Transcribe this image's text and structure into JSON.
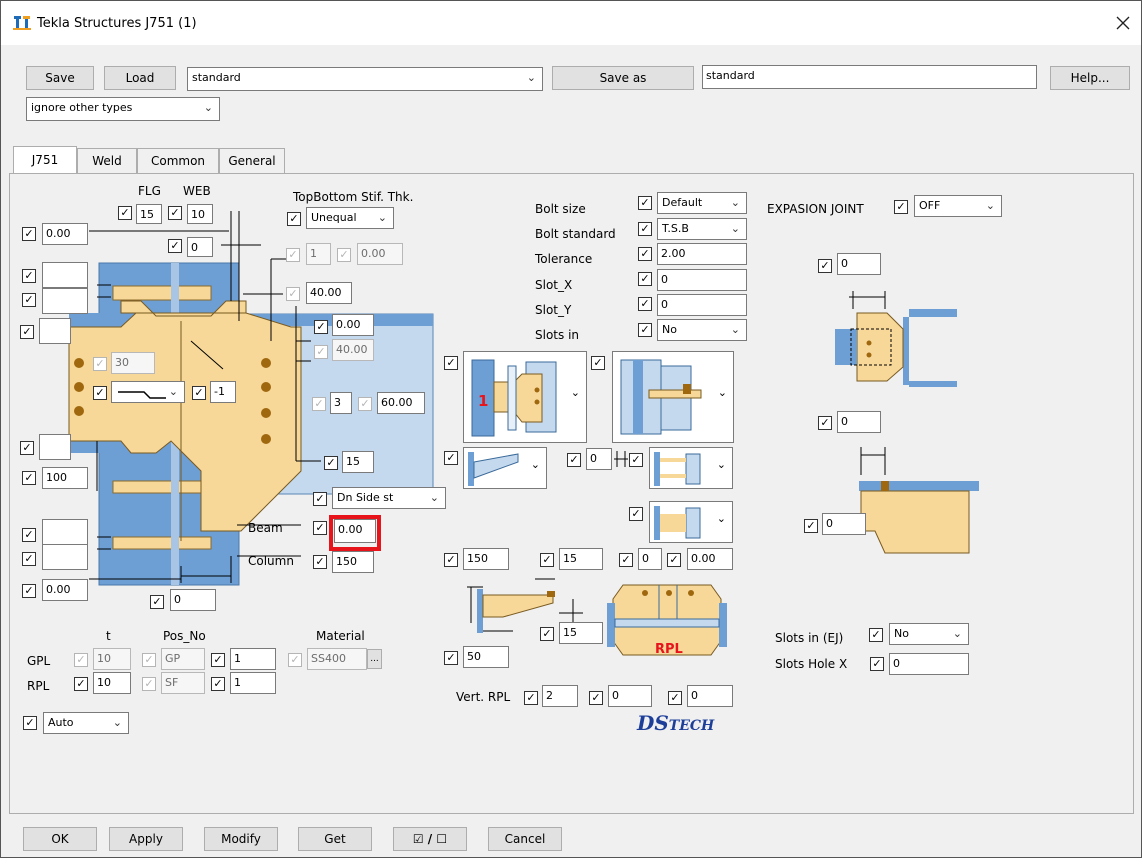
{
  "window": {
    "title": "Tekla Structures  J751 (1)"
  },
  "toolbar": {
    "save": "Save",
    "load": "Load",
    "preset": "standard",
    "save_as": "Save as",
    "save_as_name": "standard",
    "help": "Help...",
    "filter": "ignore other types"
  },
  "tabs": [
    "J751",
    "Weld",
    "Common",
    "General"
  ],
  "stiffener": {
    "flg_label": "FLG",
    "web_label": "WEB",
    "flg": "15",
    "web": "10",
    "topbottom_label": "TopBottom Stif. Thk.",
    "topbottom_value": "Unequal",
    "web_gap": "0",
    "left_top": "0.00",
    "val_1": "1",
    "val_1b": "0.00",
    "val_40": "40.00",
    "val_0_00": "0.00",
    "val_40b": "40.00",
    "val_30": "30",
    "val_m1": "-1",
    "val_3": "3",
    "val_60": "60.00",
    "val_15": "15",
    "val_100": "100",
    "side_stiff": "Dn Side st",
    "beam_label": "Beam",
    "beam_value": "0.00",
    "column_label": "Column",
    "column_value": "150",
    "bottom_left": "0.00",
    "bottom_gap": "0"
  },
  "bolt": {
    "size_label": "Bolt size",
    "size": "Default",
    "standard_label": "Bolt standard",
    "standard": "T.S.B",
    "tolerance_label": "Tolerance",
    "tolerance": "2.00",
    "slotx_label": "Slot_X",
    "slotx": "0",
    "sloty_label": "Slot_Y",
    "sloty": "0",
    "slotsin_label": "Slots in",
    "slotsin": "No"
  },
  "expansion": {
    "label": "EXPASION JOINT",
    "value": "OFF",
    "v1": "0",
    "v2": "0",
    "v3": "0",
    "slots_ej_label": "Slots in (EJ)",
    "slots_ej": "No",
    "hole_x_label": "Slots Hole X",
    "hole_x": "0"
  },
  "mid": {
    "gap_a": "0",
    "v150": "150",
    "v15a": "15",
    "v0a": "0",
    "v000": "0.00",
    "v15b": "15",
    "v50": "50",
    "vert_rpl_label": "Vert. RPL",
    "vert_rpl": "2",
    "vr2": "0",
    "vr3": "0",
    "rpl_text": "RPL",
    "beam_marker": "1"
  },
  "plates": {
    "t_label": "t",
    "posno_label": "Pos_No",
    "material_label": "Material",
    "gpl_label": "GPL",
    "gpl_t": "10",
    "gpl_prefix": "GP",
    "gpl_no": "1",
    "gpl_material": "SS400",
    "rpl_label": "RPL",
    "rpl_t": "10",
    "rpl_prefix": "SF",
    "rpl_no": "1",
    "auto": "Auto",
    "browse": "..."
  },
  "logo": {
    "ds": "DS",
    "tech": "TECH"
  },
  "footer": {
    "ok": "OK",
    "apply": "Apply",
    "modify": "Modify",
    "get": "Get",
    "toggle": "☑ / ☐",
    "cancel": "Cancel"
  },
  "colors": {
    "steel_blue": "#6d9ed4",
    "light_blue": "#c5d9ee",
    "plate_tan": "#f7d899",
    "bolt_brown": "#a0680e",
    "highlight_red": "#e8141b"
  },
  "icons": [
    "app-icon",
    "close-icon",
    "chevron-down-icon"
  ]
}
